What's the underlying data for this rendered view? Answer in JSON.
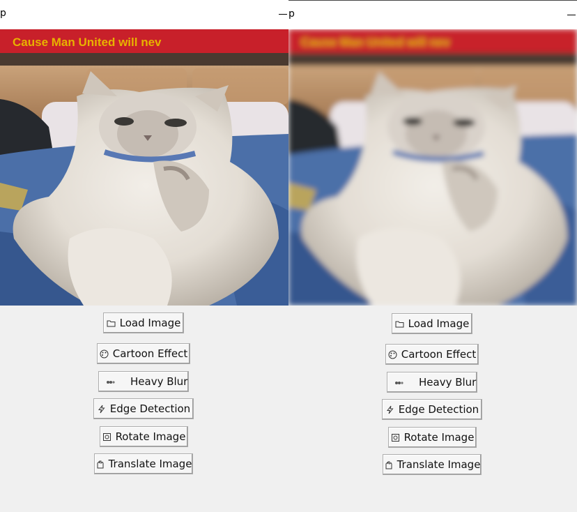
{
  "left_window": {
    "title": "p",
    "buttons": {
      "load": "Load Image",
      "cartoon": "Cartoon Effect",
      "blur": "Heavy Blur",
      "edge": "Edge Detection",
      "rotate": "Rotate Image",
      "translate": "Translate Image"
    },
    "banner_text": "Cause Man United will nev"
  },
  "right_window": {
    "title": "p",
    "buttons": {
      "load": "Load Image",
      "cartoon": "Cartoon Effect",
      "blur": "Heavy Blur",
      "edge": "Edge Detection",
      "rotate": "Rotate Image",
      "translate": "Translate Image"
    },
    "banner_text": "Cause Man United will nev"
  },
  "icons": {
    "load": "folder-icon",
    "cartoon": "palette-icon",
    "blur": "blur-icon",
    "edge": "lightning-icon",
    "rotate": "rotate-icon",
    "translate": "hand-icon"
  },
  "colors": {
    "window_bg": "#f0f0f0",
    "banner_red": "#c8202a",
    "banner_text": "#e8b200"
  }
}
